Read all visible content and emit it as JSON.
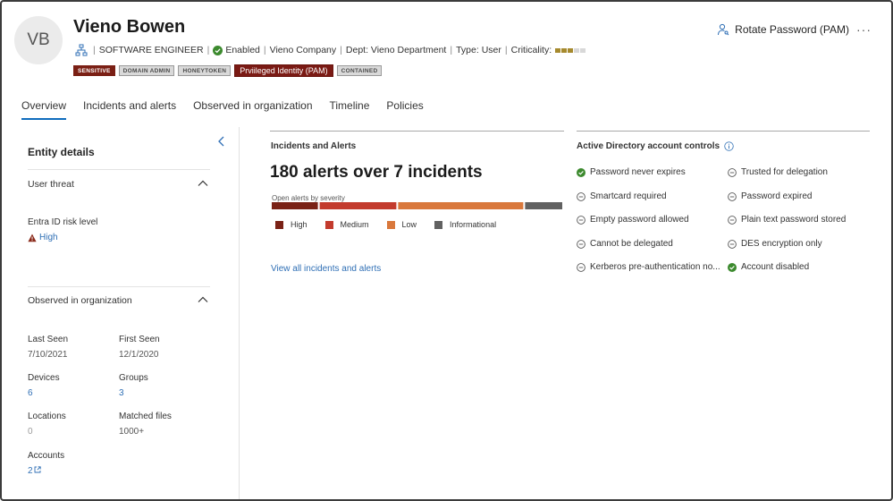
{
  "profile": {
    "initials": "VB",
    "name": "Vieno Bowen",
    "title": "SOFTWARE ENGINEER",
    "status": "Enabled",
    "company": "Vieno Company",
    "department": "Dept: Vieno Department",
    "type": "Type: User",
    "criticality_label": "Criticality:",
    "criticality_level": "3 of 5",
    "criticality_colors": {
      "filled": "#a68a2e",
      "empty": "#d8d8d8"
    },
    "tags": [
      "SENSITIVE",
      "DOMAIN ADMIN",
      "HONEYTOKEN",
      "Prviileged Identity (PAM)",
      "CONTAINED"
    ]
  },
  "header_actions": {
    "rotate_label": "Rotate",
    "password_label": "Password (PAM)",
    "more_label": "···"
  },
  "tabs": [
    "Overview",
    "Incidents and alerts",
    "Observed in organization",
    "Timeline",
    "Policies"
  ],
  "entity_details": {
    "title": "Entity details",
    "user_threat": {
      "title": "User threat",
      "risk_label": "Entra ID risk level",
      "risk_value": "High"
    },
    "observed": {
      "title": "Observed in organization",
      "last_seen_label": "Last Seen",
      "last_seen_value": "7/10/2021",
      "first_seen_label": "First Seen",
      "first_seen_value": "12/1/2020",
      "devices_label": "Devices",
      "devices_value": "6",
      "groups_label": "Groups",
      "groups_value": "3",
      "locations_label": "Locations",
      "locations_value": "0",
      "matched_files_label": "Matched files",
      "matched_files_value": "1000+",
      "accounts_label": "Accounts",
      "accounts_value": "2"
    }
  },
  "incidents": {
    "title": "Incidents and Alerts",
    "headline": "180 alerts over 7 incidents",
    "severity_caption": "Open alerts by severity",
    "severity": [
      {
        "name": "High",
        "fraction": 0.165,
        "color": "#7a2216"
      },
      {
        "name": "Medium",
        "fraction": 0.27,
        "color": "#c33b2d"
      },
      {
        "name": "Low",
        "fraction": 0.437,
        "color": "#d9783c"
      },
      {
        "name": "Informational",
        "fraction": 0.128,
        "color": "#616161"
      }
    ],
    "view_link": "View all incidents and alerts"
  },
  "ad_controls": {
    "title": "Active Directory account controls",
    "left": [
      {
        "label": "Password never expires",
        "state": "enabled"
      },
      {
        "label": "Smartcard required",
        "state": "disabled"
      },
      {
        "label": "Empty password allowed",
        "state": "disabled"
      },
      {
        "label": "Cannot be delegated",
        "state": "disabled"
      },
      {
        "label": "Kerberos pre-authentication no...",
        "state": "disabled"
      }
    ],
    "right": [
      {
        "label": "Trusted for delegation",
        "state": "disabled"
      },
      {
        "label": "Password expired",
        "state": "disabled"
      },
      {
        "label": "Plain text password stored",
        "state": "disabled"
      },
      {
        "label": "DES encryption only",
        "state": "disabled"
      },
      {
        "label": "Account disabled",
        "state": "enabled"
      }
    ]
  },
  "colors": {
    "accent": "#0f6cbd",
    "link": "#2f6fb5",
    "enabled_green": "#3c8a2e",
    "risk_red": "#8a2a1a"
  }
}
